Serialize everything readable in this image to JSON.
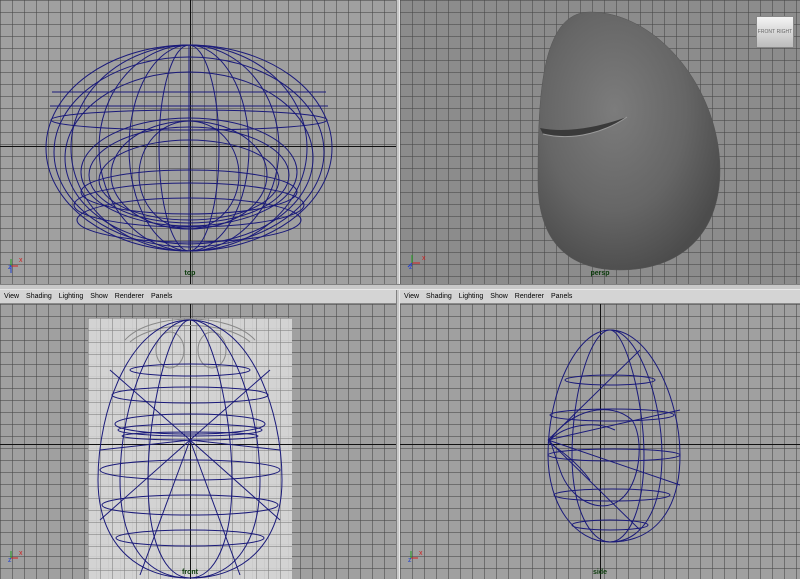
{
  "viewports": {
    "top": {
      "camera_label": "top"
    },
    "persp": {
      "camera_label": "persp"
    },
    "front": {
      "camera_label": "front"
    },
    "side": {
      "camera_label": "side"
    }
  },
  "panel_menu": [
    "View",
    "Shading",
    "Lighting",
    "Show",
    "Renderer",
    "Panels"
  ],
  "viewcube": {
    "face_front": "FRONT",
    "face_right": "RIGHT"
  },
  "axis_labels": {
    "x": "x",
    "y": "y",
    "z": "z"
  },
  "colors": {
    "wire": "#1a1a7a",
    "grid_bg": "#a0a0a0",
    "persp_bg": "#8c8c8c",
    "axis_x": "#d02020",
    "axis_y": "#20a020",
    "axis_z": "#2040d0",
    "image_plane": "#dcdcdc"
  }
}
